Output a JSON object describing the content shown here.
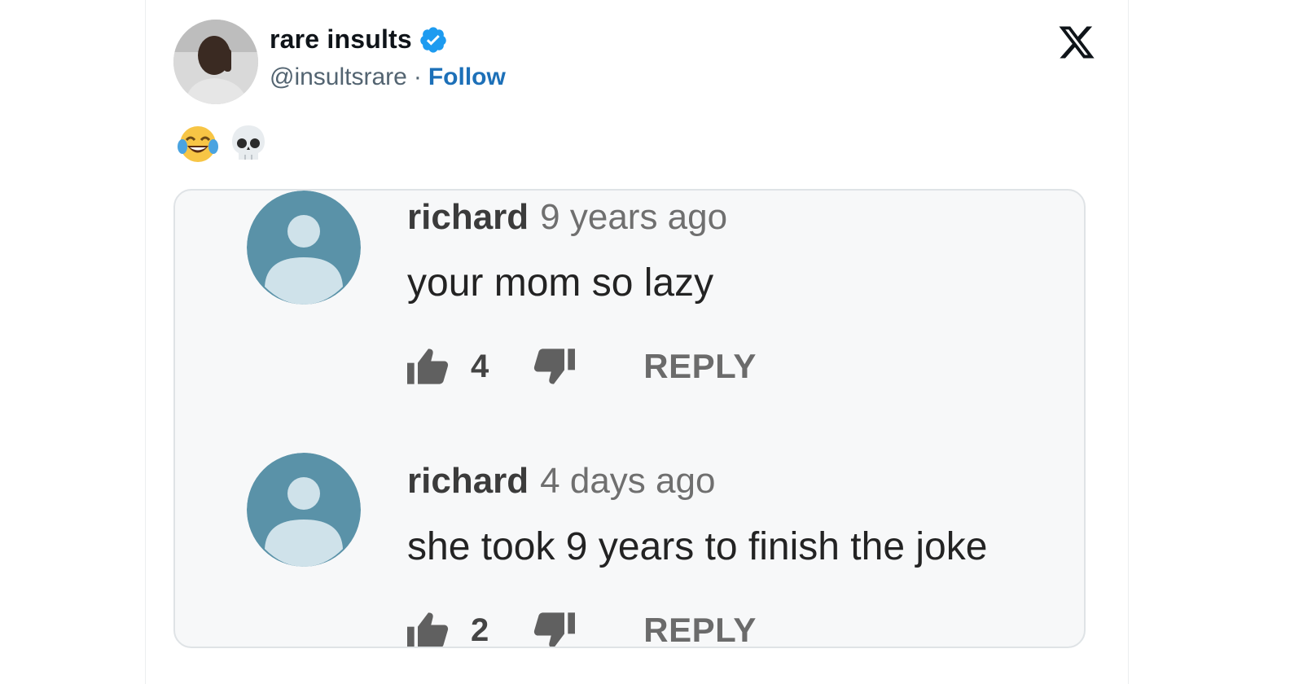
{
  "header": {
    "display_name": "rare insults",
    "handle": "@insultsrare",
    "separator": "·",
    "follow_label": "Follow"
  },
  "post": {
    "emojis": [
      "face-with-tears-of-joy",
      "skull"
    ]
  },
  "comments": [
    {
      "user": "richard",
      "time": "9 years ago",
      "text": "your mom so lazy",
      "likes": "4",
      "reply_label": "REPLY"
    },
    {
      "user": "richard",
      "time": "4 days ago",
      "text": "she took 9 years to finish the joke",
      "likes": "2",
      "reply_label": "REPLY"
    }
  ],
  "colors": {
    "follow": "#1d70b8",
    "verified": "#1d9bf0",
    "avatar_bg": "#5a92a8",
    "avatar_fg": "#cfe2ea"
  }
}
